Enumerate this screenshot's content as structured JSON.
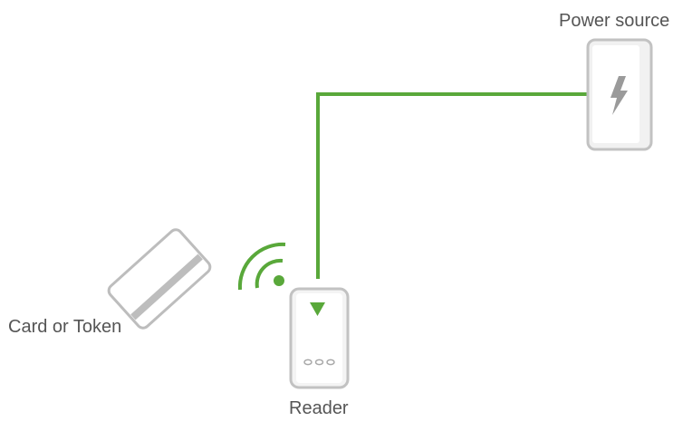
{
  "labels": {
    "power_source": "Power source",
    "card": "Card or Token",
    "reader": "Reader"
  },
  "colors": {
    "wire": "#59a83a",
    "outline": "#bdbdbd",
    "fill": "#f4f4f4",
    "icon": "#9a9a9a",
    "text": "#555555"
  },
  "icons": {
    "power": "lightning-bolt-icon",
    "wireless": "wireless-signal-icon",
    "reader_indicator": "triangle-down-icon",
    "reader_buttons": "three-dots-icon"
  }
}
